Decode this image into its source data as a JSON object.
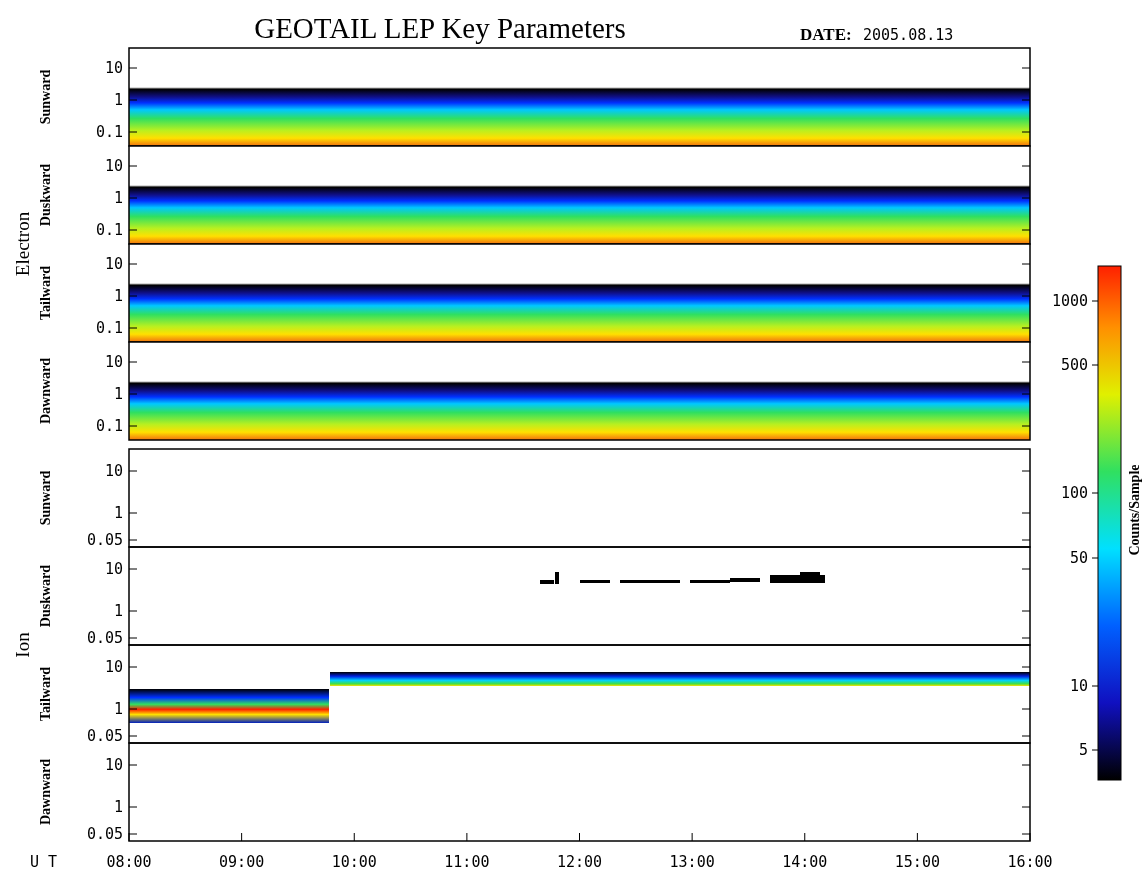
{
  "title": "GEOTAIL LEP Key Parameters",
  "date": {
    "label": "DATE:",
    "value": "2005.08.13"
  },
  "groups": [
    {
      "name": "Electron",
      "panels": [
        {
          "label": "Sunward",
          "kind": "electron",
          "yticks": [
            "10",
            "1",
            "0.1"
          ]
        },
        {
          "label": "Duskward",
          "kind": "electron",
          "yticks": [
            "10",
            "1",
            "0.1"
          ]
        },
        {
          "label": "Tailward",
          "kind": "electron",
          "yticks": [
            "10",
            "1",
            "0.1"
          ]
        },
        {
          "label": "Dawnward",
          "kind": "electron",
          "yticks": [
            "10",
            "1",
            "0.1"
          ]
        }
      ]
    },
    {
      "name": "Ion",
      "panels": [
        {
          "label": "Sunward",
          "kind": "empty",
          "yticks": [
            "10",
            "1",
            "0.05"
          ]
        },
        {
          "label": "Duskward",
          "kind": "sparse",
          "yticks": [
            "10",
            "1",
            "0.05"
          ]
        },
        {
          "label": "Tailward",
          "kind": "band",
          "yticks": [
            "10",
            "1",
            "0.05"
          ]
        },
        {
          "label": "Dawnward",
          "kind": "empty",
          "yticks": [
            "10",
            "1",
            "0.05"
          ]
        }
      ]
    }
  ],
  "x_axis": {
    "label": "U T",
    "ticks": [
      "08:00",
      "09:00",
      "10:00",
      "11:00",
      "12:00",
      "13:00",
      "14:00",
      "15:00",
      "16:00"
    ]
  },
  "colorbar": {
    "label": "Counts/Sample",
    "ticks": [
      "1000",
      "500",
      "100",
      "50",
      "10",
      "5"
    ]
  }
}
